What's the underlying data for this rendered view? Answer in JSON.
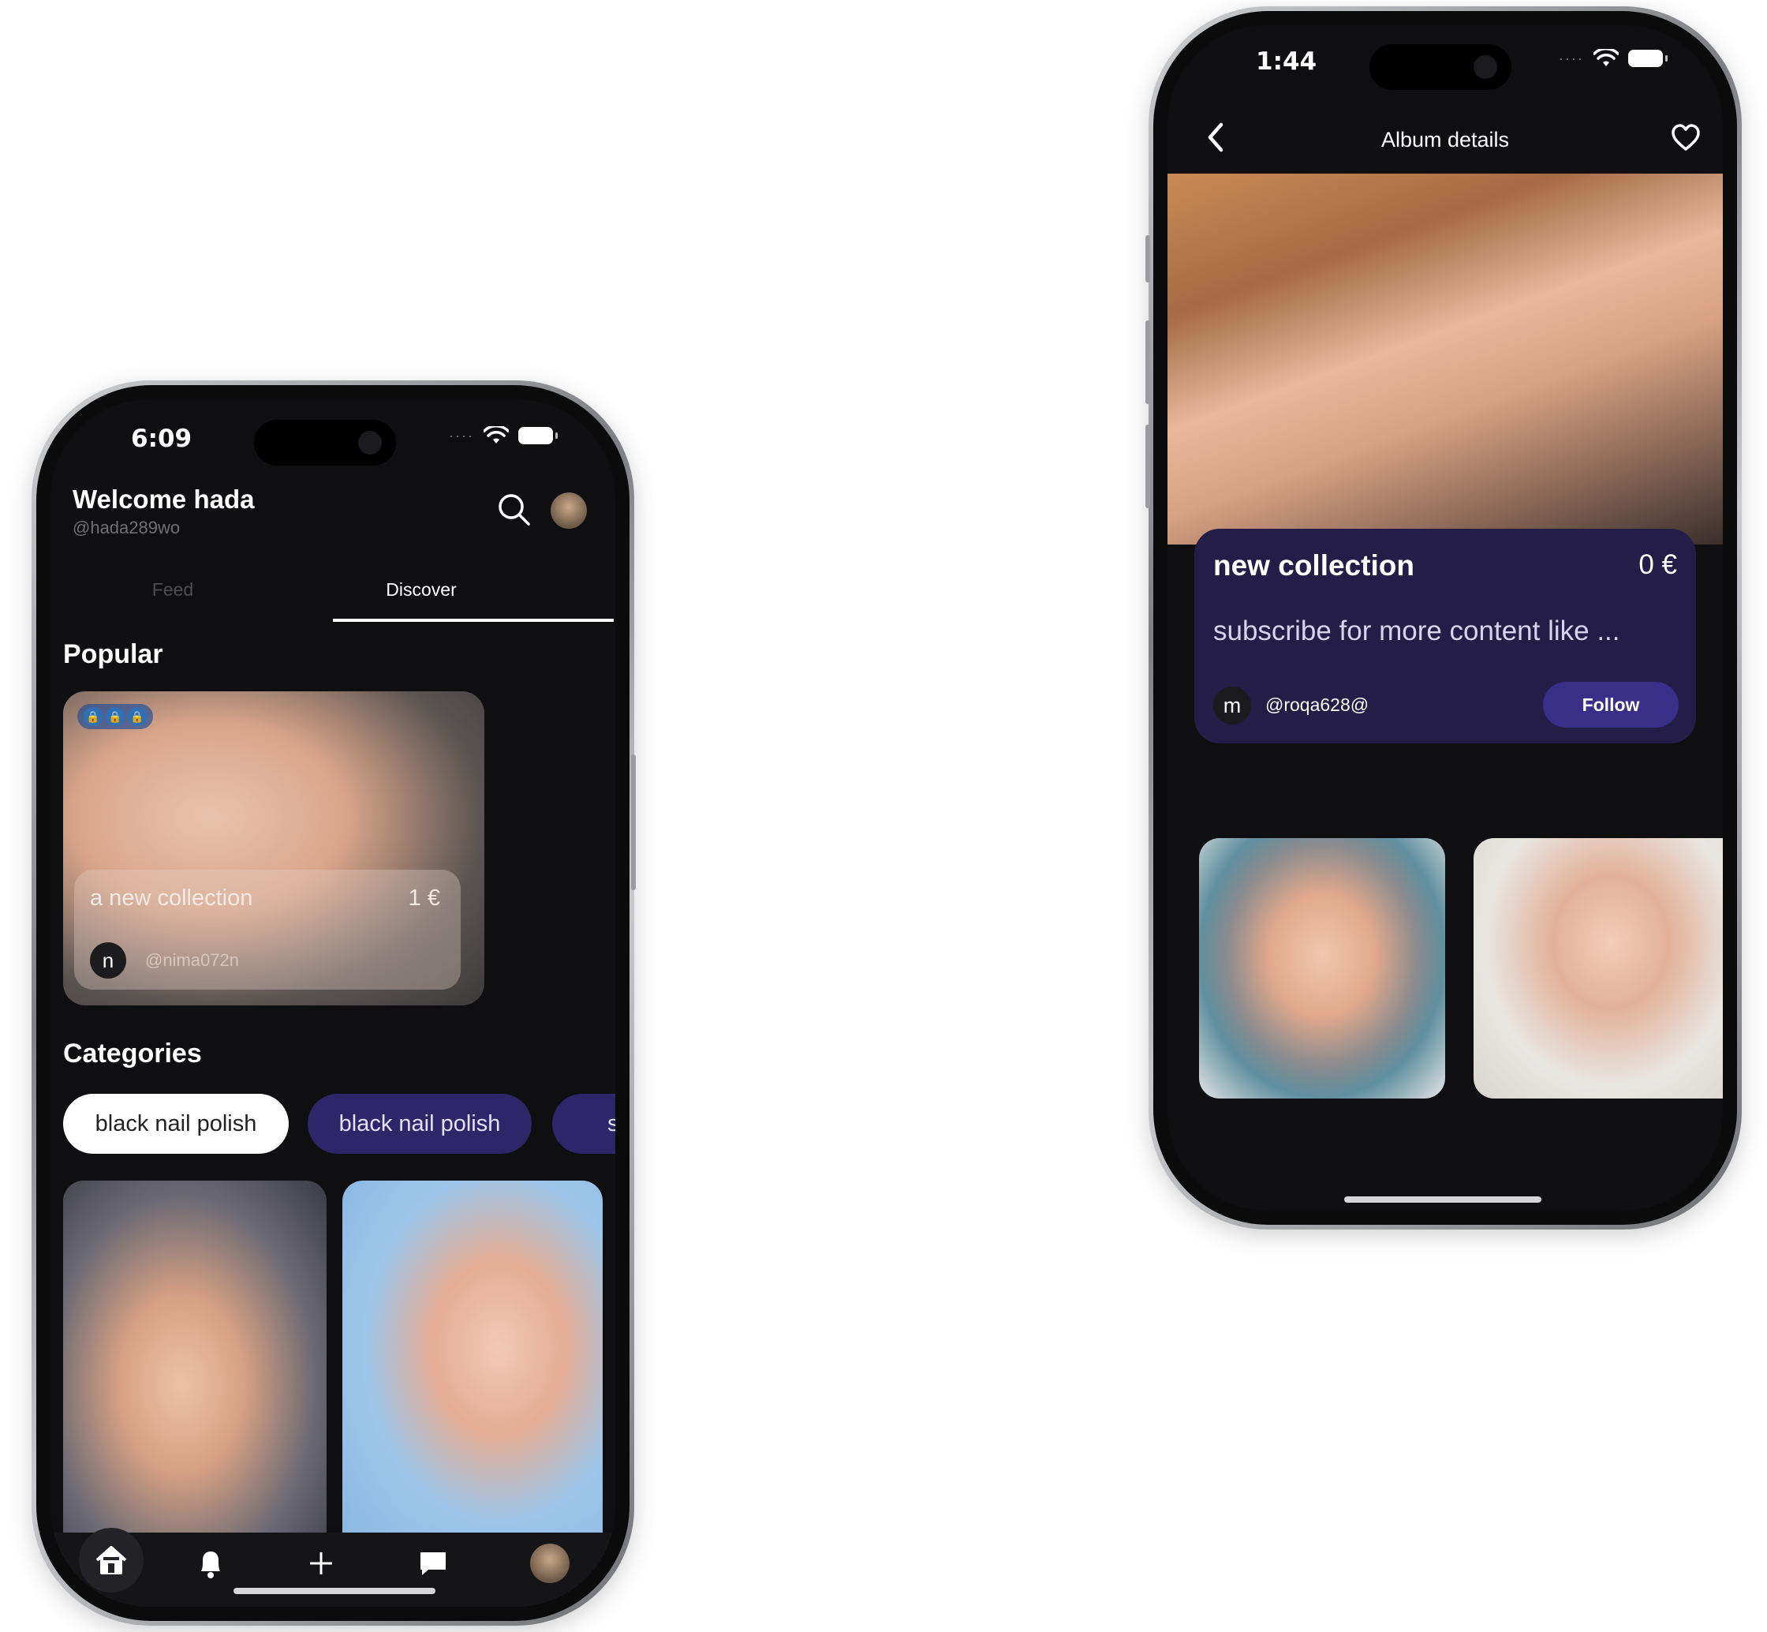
{
  "left_phone": {
    "status": {
      "time": "6:09"
    },
    "header": {
      "welcome": "Welcome hada",
      "handle": "@hada289wo"
    },
    "tabs": [
      {
        "label": "Feed",
        "active": false
      },
      {
        "label": "Discover",
        "active": true
      }
    ],
    "popular": {
      "heading": "Popular",
      "card": {
        "title": "a new collection",
        "price": "1 €",
        "avatar_letter": "n",
        "user": "@nima072n",
        "lock_icons": [
          "lock-icon",
          "lock-icon",
          "lock-icon"
        ]
      }
    },
    "categories": {
      "heading": "Categories",
      "chips": [
        {
          "label": "black nail polish",
          "selected": true
        },
        {
          "label": "black nail polish",
          "selected": false
        },
        {
          "label": "s",
          "selected": false
        }
      ]
    },
    "bottom_nav": [
      "home-icon",
      "bell-icon",
      "plus-icon",
      "chat-icon",
      "avatar"
    ]
  },
  "right_phone": {
    "status": {
      "time": "1:44"
    },
    "header": {
      "title": "Album details"
    },
    "album": {
      "title": "new collection",
      "price": "0 €",
      "description": "subscribe for more content like ...",
      "avatar_letter": "m",
      "user": "@roqa628@",
      "follow_label": "Follow"
    }
  },
  "colors": {
    "accent": "#2e2668",
    "card_bg": "#241d47",
    "screen_bg": "#0f0e10"
  }
}
